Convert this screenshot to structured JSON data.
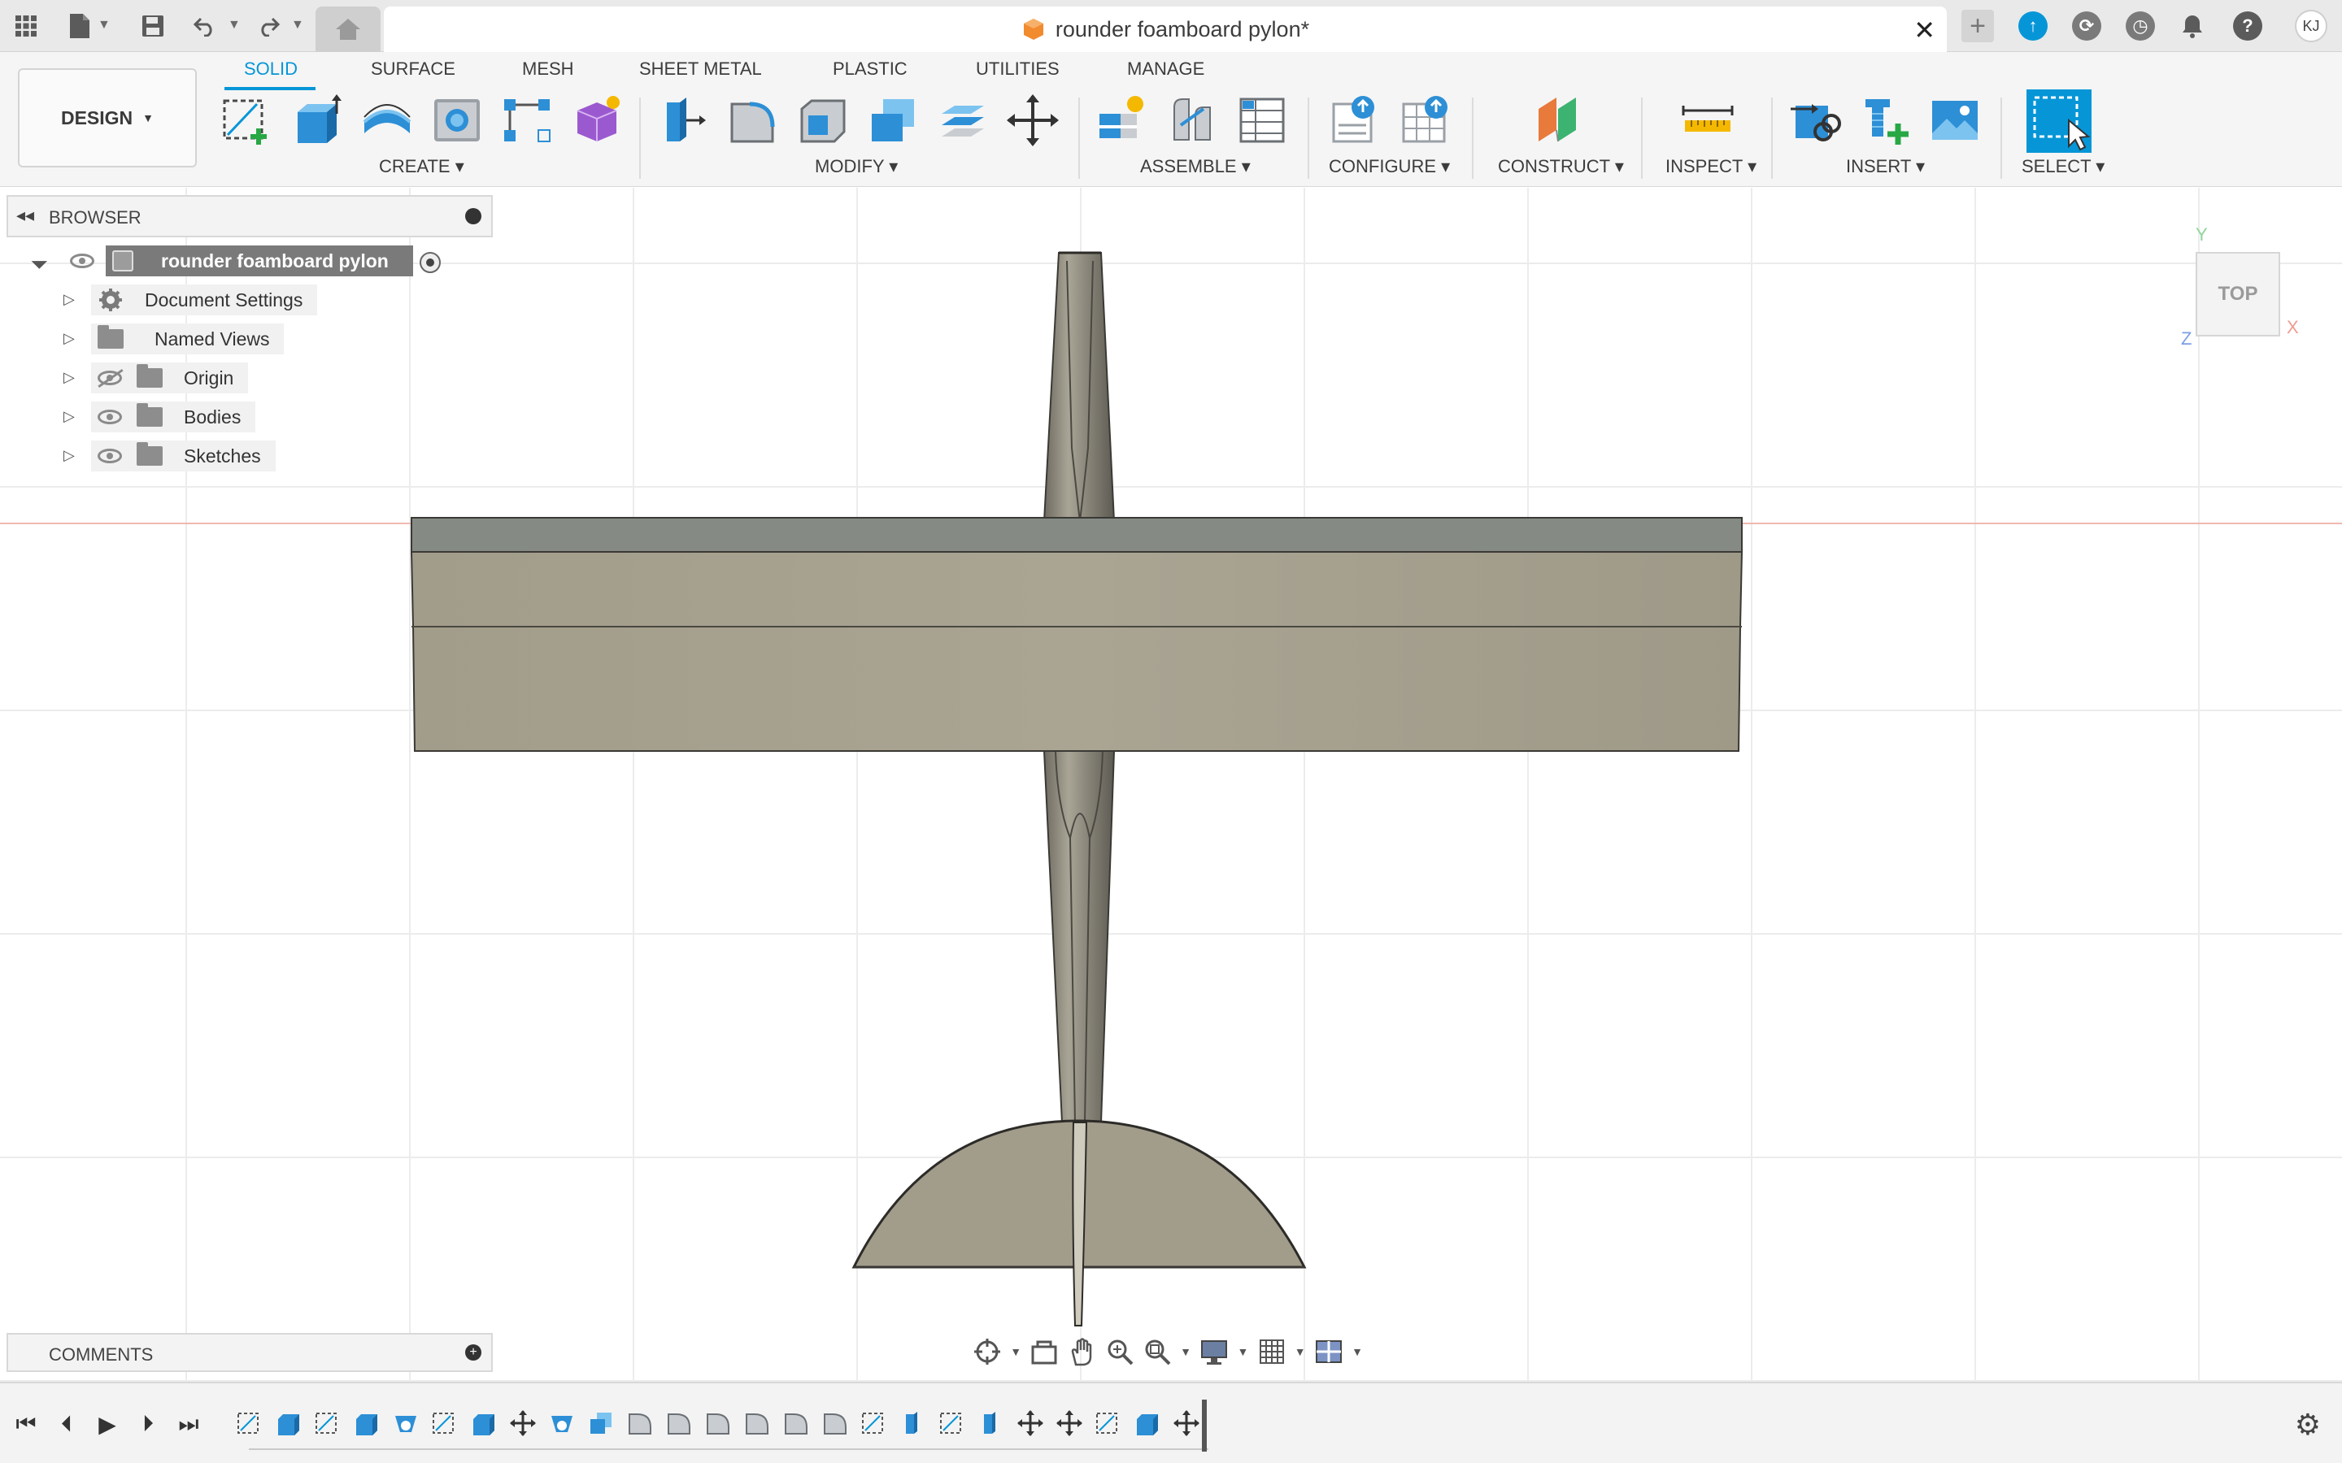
{
  "app": {
    "document_title": "rounder foamboard pylon*",
    "user_initials": "KJ"
  },
  "toolbar": {
    "workspace_label": "DESIGN",
    "tabs": [
      {
        "label": "SOLID",
        "active": true
      },
      {
        "label": "SURFACE",
        "active": false
      },
      {
        "label": "MESH",
        "active": false
      },
      {
        "label": "SHEET METAL",
        "active": false
      },
      {
        "label": "PLASTIC",
        "active": false
      },
      {
        "label": "UTILITIES",
        "active": false
      },
      {
        "label": "MANAGE",
        "active": false
      }
    ],
    "groups": {
      "create": "CREATE",
      "modify": "MODIFY",
      "assemble": "ASSEMBLE",
      "configure": "CONFIGURE",
      "construct": "CONSTRUCT",
      "inspect": "INSPECT",
      "insert": "INSERT",
      "select": "SELECT"
    }
  },
  "browser": {
    "title": "BROWSER",
    "root": "rounder foamboard pylon",
    "items": [
      {
        "label": "Document Settings",
        "icon": "gear-icon"
      },
      {
        "label": "Named Views",
        "icon": "folder-icon"
      },
      {
        "label": "Origin",
        "icon": "folder-icon",
        "hidden": true
      },
      {
        "label": "Bodies",
        "icon": "folder-icon"
      },
      {
        "label": "Sketches",
        "icon": "folder-icon"
      }
    ]
  },
  "comments": {
    "title": "COMMENTS"
  },
  "viewcube": {
    "face": "TOP",
    "axis_y": "Y",
    "axis_x": "X",
    "axis_z": "Z"
  },
  "colors": {
    "accent": "#0696d7",
    "body_face": "#a29c8c",
    "body_top": "#858a84",
    "x_axis": "#f0b8b0",
    "y_axis": "#8fd69a",
    "z_axis": "#7b9fe6"
  }
}
